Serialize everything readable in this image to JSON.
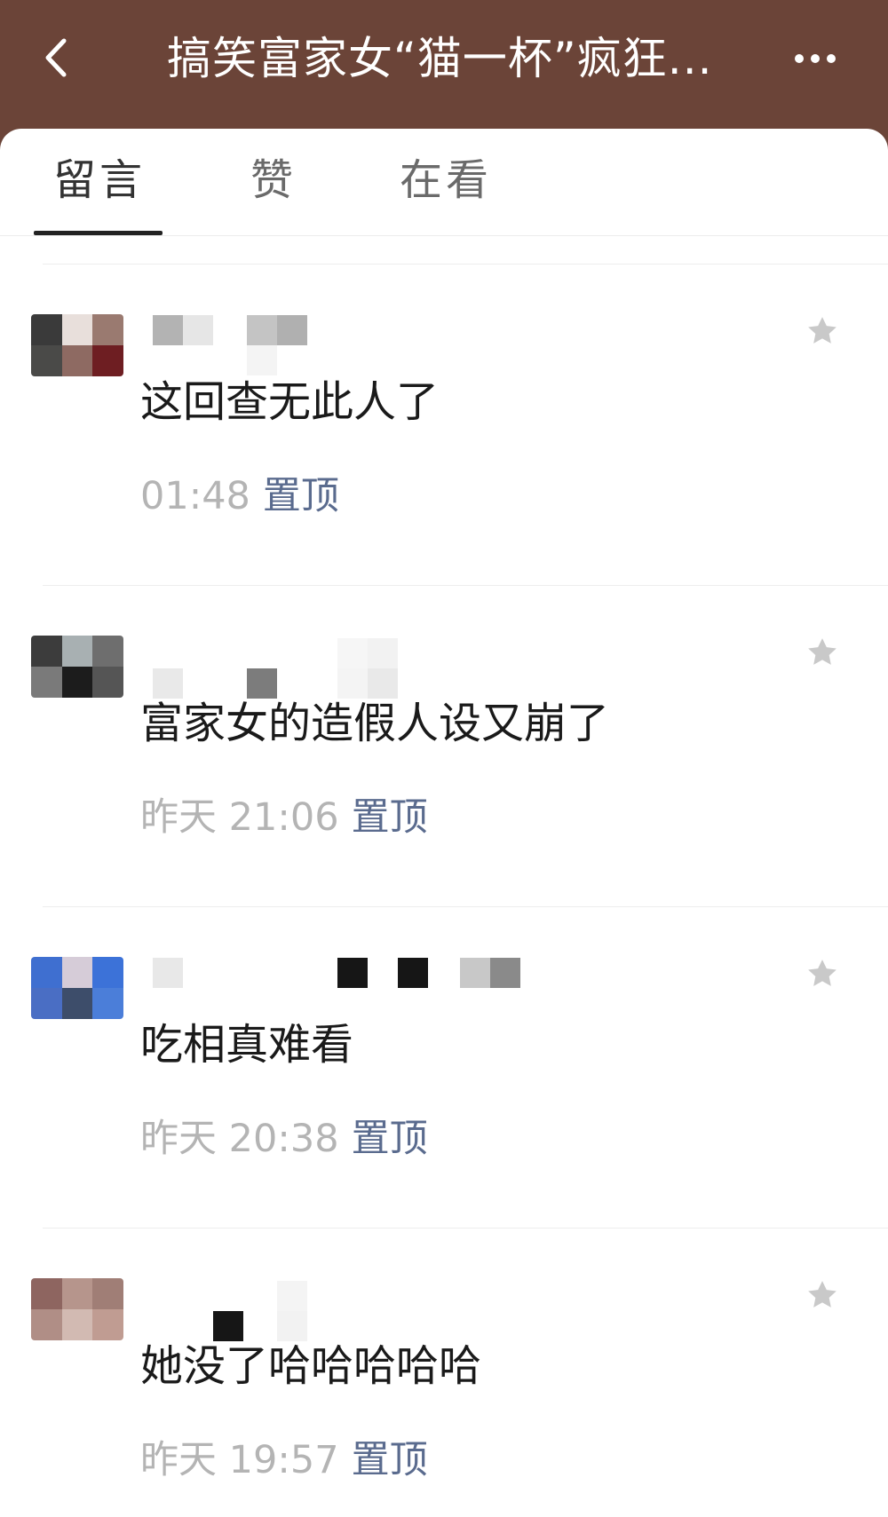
{
  "header": {
    "title": "搞笑富家女“猫一杯”疯狂...",
    "back_icon": "chevron-left-icon",
    "more_icon": "more-dots-icon"
  },
  "tabs": [
    {
      "label": "留言",
      "active": true
    },
    {
      "label": "赞",
      "active": false
    },
    {
      "label": "在看",
      "active": false
    }
  ],
  "comments": [
    {
      "text": "这回查无此人了",
      "time": "01:48",
      "pin_label": "置顶"
    },
    {
      "text": "富家女的造假人设又崩了",
      "time": "昨天 21:06",
      "pin_label": "置顶"
    },
    {
      "text": "吃相真难看",
      "time": "昨天 20:38",
      "pin_label": "置顶"
    },
    {
      "text": "她没了哈哈哈哈哈",
      "time": "昨天 19:57",
      "pin_label": "置顶"
    }
  ],
  "colors": {
    "header_bg": "#6b4438",
    "pin_link": "#5a6b8e",
    "timestamp": "#b4b4b4"
  }
}
